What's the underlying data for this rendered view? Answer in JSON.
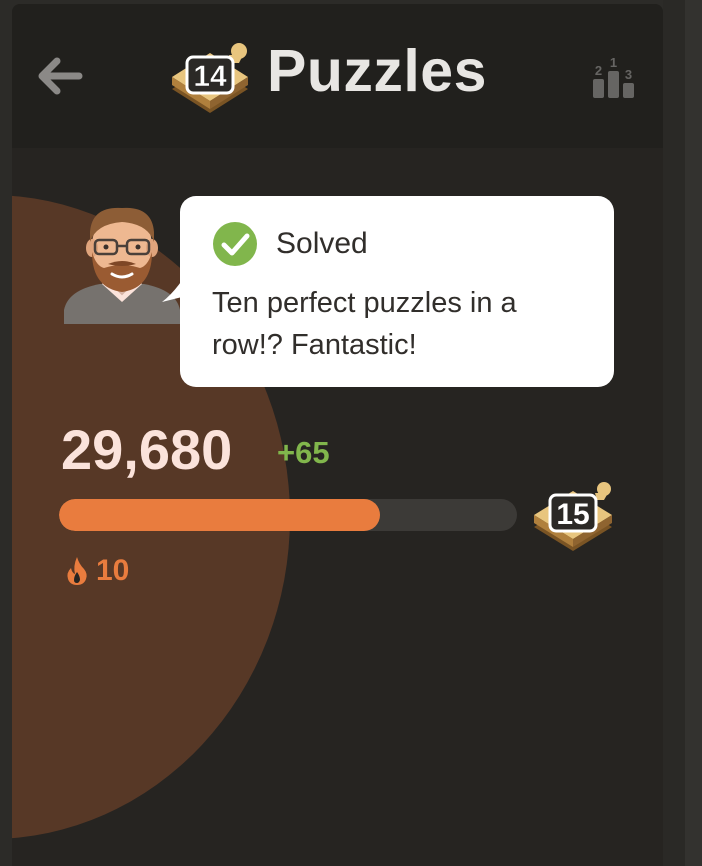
{
  "header": {
    "title": "Puzzles",
    "level_badge": "14",
    "back_icon": "arrow-left-icon",
    "leaderboard_icon": "leaderboard-icon",
    "leaderboard_ranks": [
      "2",
      "1",
      "3"
    ]
  },
  "coach": {
    "avatar_icon": "coach-avatar-icon",
    "status_icon": "checkmark-circle-icon",
    "status": "Solved",
    "message": "Ten perfect puzzles in a row!? Fantastic!"
  },
  "progress": {
    "rating": "29,680",
    "delta": "+65",
    "fraction": 0.7,
    "next_level_badge": "15",
    "streak_icon": "flame-icon",
    "streak": "10"
  },
  "colors": {
    "accent": "#e97c3e",
    "success": "#81b64c",
    "background": "#262421",
    "header_bg": "#21201d",
    "glow": "#573826",
    "rating_text": "#fbe3db"
  }
}
